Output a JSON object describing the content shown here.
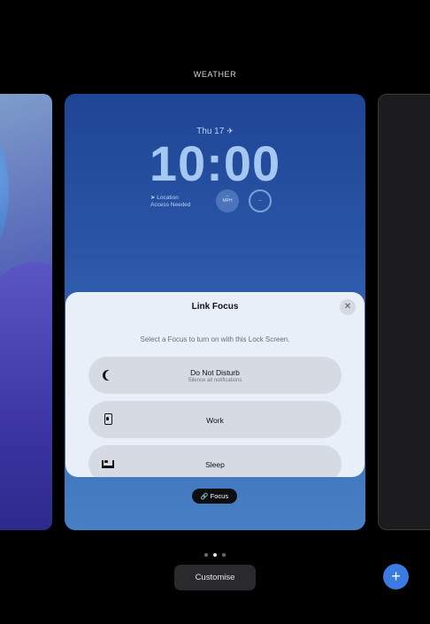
{
  "header": {
    "wallpaper_label": "WEATHER"
  },
  "lock_screen": {
    "date": "Thu 17",
    "time": "10:00",
    "location_widget": {
      "line1": "Location",
      "line2": "Access Needed"
    },
    "widget_circle_1": {
      "value": "--",
      "unit": "MPH"
    },
    "widget_circle_2": {
      "value": "--"
    },
    "focus_chip_label": "Focus"
  },
  "sheet": {
    "title": "Link Focus",
    "subtitle": "Select a Focus to turn on with this Lock Screen.",
    "options": [
      {
        "label": "Do Not Disturb",
        "sublabel": "Silence all notifications",
        "icon": "moon-icon"
      },
      {
        "label": "Work",
        "icon": "badge-icon"
      },
      {
        "label": "Sleep",
        "icon": "bed-icon"
      }
    ]
  },
  "footer": {
    "page_dots": 3,
    "active_dot": 2,
    "customise_label": "Customise",
    "add_label": "+"
  },
  "colors": {
    "accent": "#3b7ae0",
    "card_gradient_top": "#1f4595",
    "card_gradient_bottom": "#4880c4",
    "sheet_bg": "#e9eff8"
  }
}
